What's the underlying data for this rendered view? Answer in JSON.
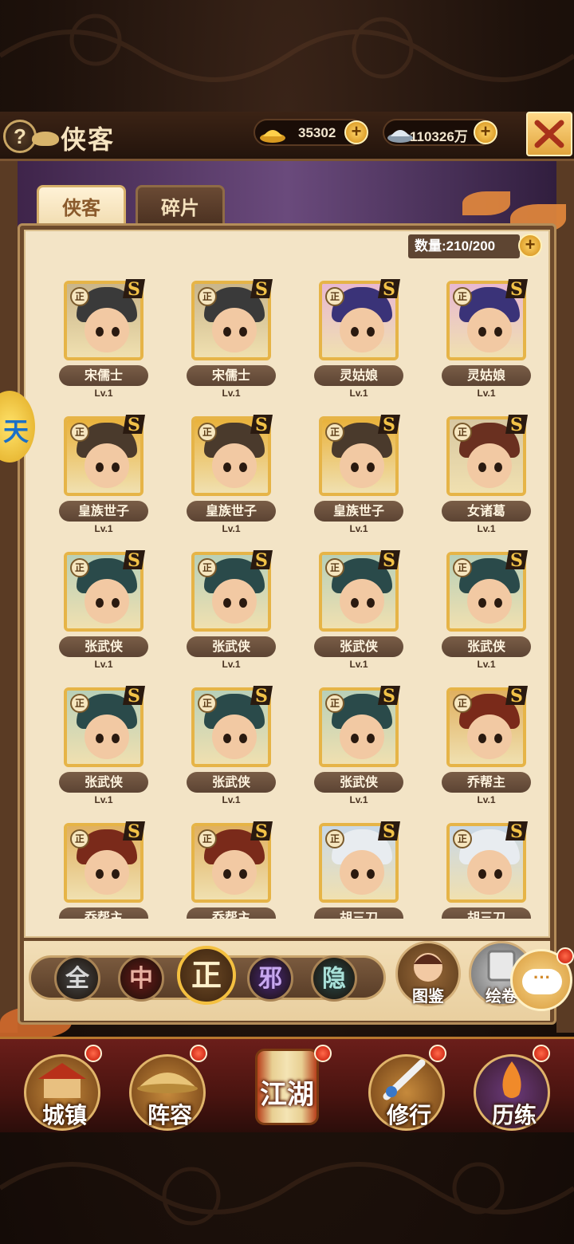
{
  "header": {
    "help_label": "?",
    "title": "侠客",
    "gold": "35302",
    "silver": "110326万",
    "plus": "+"
  },
  "tabs": [
    {
      "label": "侠客",
      "selected": true
    },
    {
      "label": "碎片",
      "selected": false
    }
  ],
  "count_label": "数量:210/200",
  "faction_badge": "正",
  "grade_badge": "S",
  "heroes": [
    {
      "name": "宋儒士",
      "level": "Lv.1",
      "hair": "#3a3a3a",
      "bg": "#c9b58a"
    },
    {
      "name": "宋儒士",
      "level": "Lv.1",
      "hair": "#3a3a3a",
      "bg": "#c9b58a"
    },
    {
      "name": "灵姑娘",
      "level": "Lv.1",
      "hair": "#3a3378",
      "bg": "#e8b8d2"
    },
    {
      "name": "灵姑娘",
      "level": "Lv.1",
      "hair": "#3a3378",
      "bg": "#e8b8d2"
    },
    {
      "name": "皇族世子",
      "level": "Lv.1",
      "hair": "#4a3a2c",
      "bg": "#e9b23c"
    },
    {
      "name": "皇族世子",
      "level": "Lv.1",
      "hair": "#4a3a2c",
      "bg": "#e9b23c"
    },
    {
      "name": "皇族世子",
      "level": "Lv.1",
      "hair": "#4a3a2c",
      "bg": "#e9b23c"
    },
    {
      "name": "女诸葛",
      "level": "Lv.1",
      "hair": "#6a3020",
      "bg": "#d8c8a2"
    },
    {
      "name": "张武侠",
      "level": "Lv.1",
      "hair": "#2a4a4a",
      "bg": "#b8d0b8"
    },
    {
      "name": "张武侠",
      "level": "Lv.1",
      "hair": "#2a4a4a",
      "bg": "#b8d0b8"
    },
    {
      "name": "张武侠",
      "level": "Lv.1",
      "hair": "#2a4a4a",
      "bg": "#b8d0b8"
    },
    {
      "name": "张武侠",
      "level": "Lv.1",
      "hair": "#2a4a4a",
      "bg": "#b8d0b8"
    },
    {
      "name": "张武侠",
      "level": "Lv.1",
      "hair": "#2a4a4a",
      "bg": "#b8d0b8"
    },
    {
      "name": "张武侠",
      "level": "Lv.1",
      "hair": "#2a4a4a",
      "bg": "#b8d0b8"
    },
    {
      "name": "张武侠",
      "level": "Lv.1",
      "hair": "#2a4a4a",
      "bg": "#b8d0b8"
    },
    {
      "name": "乔帮主",
      "level": "Lv.1",
      "hair": "#7a2a1a",
      "bg": "#e0b060"
    },
    {
      "name": "乔帮主",
      "level": "",
      "hair": "#7a2a1a",
      "bg": "#e0b060"
    },
    {
      "name": "乔帮主",
      "level": "",
      "hair": "#7a2a1a",
      "bg": "#e0b060"
    },
    {
      "name": "胡三刀",
      "level": "",
      "hair": "#e8ecf0",
      "bg": "#c8d8e8"
    },
    {
      "name": "胡三刀",
      "level": "",
      "hair": "#e8ecf0",
      "bg": "#c8d8e8"
    }
  ],
  "filters": [
    {
      "label": "全",
      "color": "#4a4a4a",
      "text": "#d8d8d8"
    },
    {
      "label": "中",
      "color": "#6a1a1a",
      "text": "#e8b0a0"
    },
    {
      "label": "正",
      "color": "#6d4a26",
      "text": "#fff2cc"
    },
    {
      "label": "邪",
      "color": "#4a2a7a",
      "text": "#c8a8f0"
    },
    {
      "label": "隐",
      "color": "#2a4a4a",
      "text": "#a8e0d8"
    }
  ],
  "buttons": {
    "tujian": "图鉴",
    "huijuan": "绘卷",
    "chat": "···"
  },
  "nav": {
    "town": "城镇",
    "lineup": "阵容",
    "jianghu": "江湖",
    "cultivate": "修行",
    "train": "历练"
  },
  "side_peek": "天"
}
